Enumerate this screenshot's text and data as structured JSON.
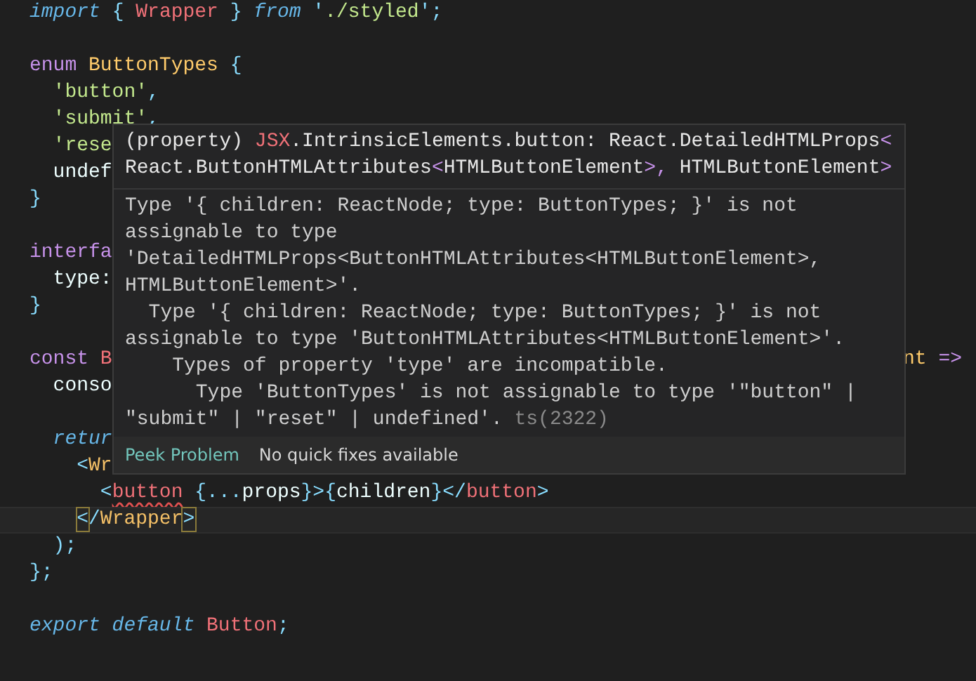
{
  "editor": {
    "lines": [
      {
        "tokens": [
          {
            "text": "import",
            "kind": "keyword-italic"
          },
          {
            "text": " { ",
            "kind": "punct"
          },
          {
            "text": "Wrapper",
            "kind": "ident"
          },
          {
            "text": " } ",
            "kind": "punct"
          },
          {
            "text": "from",
            "kind": "keyword-italic"
          },
          {
            "text": " '",
            "kind": "punct"
          },
          {
            "text": "./styled",
            "kind": "string"
          },
          {
            "text": "';",
            "kind": "punct"
          }
        ],
        "gap_after": true
      },
      {
        "tokens": [
          {
            "text": "enum ",
            "kind": "keyword"
          },
          {
            "text": "ButtonTypes",
            "kind": "type"
          },
          {
            "text": " {",
            "kind": "punct"
          }
        ]
      },
      {
        "tokens": [
          {
            "text": "  'button'",
            "kind": "string"
          },
          {
            "text": ",",
            "kind": "punct"
          }
        ]
      },
      {
        "tokens": [
          {
            "text": "  'submit'",
            "kind": "string"
          },
          {
            "text": ",",
            "kind": "punct"
          }
        ]
      },
      {
        "tokens": [
          {
            "text": "  'rese",
            "kind": "string"
          }
        ]
      },
      {
        "tokens": [
          {
            "text": "  undef",
            "kind": "plain"
          }
        ]
      },
      {
        "tokens": [
          {
            "text": "}",
            "kind": "punct"
          }
        ],
        "gap_after": true
      },
      {
        "tokens": [
          {
            "text": "interfa",
            "kind": "keyword"
          }
        ]
      },
      {
        "tokens": [
          {
            "text": "  type:",
            "kind": "plain"
          }
        ]
      },
      {
        "tokens": [
          {
            "text": "}",
            "kind": "punct"
          }
        ],
        "gap_after": true
      },
      {
        "tokens": [
          {
            "text": "const ",
            "kind": "keyword"
          },
          {
            "text": "B",
            "kind": "ident"
          }
        ],
        "tail": [
          {
            "text": "nt",
            "kind": "type"
          },
          {
            "text": " =>",
            "kind": "keyword"
          }
        ]
      },
      {
        "tokens": [
          {
            "text": "  conso",
            "kind": "plain"
          }
        ],
        "gap_after": true
      },
      {
        "tokens": [
          {
            "text": "  retur",
            "kind": "keyword-italic"
          }
        ]
      },
      {
        "tokens": [
          {
            "text": "    <",
            "kind": "punct"
          },
          {
            "text": "Wr",
            "kind": "tag"
          }
        ]
      },
      {
        "tokens": [
          {
            "text": "      <",
            "kind": "punct"
          },
          {
            "text": "button",
            "kind": "error"
          },
          {
            "text": " {",
            "kind": "punct"
          },
          {
            "text": "...",
            "kind": "punct"
          },
          {
            "text": "props",
            "kind": "plain"
          },
          {
            "text": "}>{",
            "kind": "punct"
          },
          {
            "text": "children",
            "kind": "plain"
          },
          {
            "text": "}</",
            "kind": "punct"
          },
          {
            "text": "button",
            "kind": "ident"
          },
          {
            "text": ">",
            "kind": "punct"
          }
        ]
      },
      {
        "current": true,
        "tokens": [
          {
            "text": "    <",
            "kind": "match"
          },
          {
            "text": "/",
            "kind": "punct"
          },
          {
            "text": "Wrapper",
            "kind": "tag"
          },
          {
            "text": ">",
            "kind": "match"
          }
        ]
      },
      {
        "tokens": [
          {
            "text": "  );",
            "kind": "punct"
          }
        ]
      },
      {
        "tokens": [
          {
            "text": "};",
            "kind": "punct"
          }
        ],
        "gap_after": true
      },
      {
        "tokens": [
          {
            "text": "export default ",
            "kind": "keyword-italic"
          },
          {
            "text": "Button",
            "kind": "ident"
          },
          {
            "text": ";",
            "kind": "punct"
          }
        ]
      }
    ]
  },
  "hover": {
    "signature": [
      {
        "text": "(property) ",
        "kind": "plain"
      },
      {
        "text": "JSX",
        "kind": "ident"
      },
      {
        "text": ".IntrinsicElements.button: React.DetailedHTMLProps",
        "kind": "plain"
      },
      {
        "text": "<",
        "kind": "angle"
      },
      {
        "text": "\nReact.ButtonHTMLAttributes",
        "kind": "plain"
      },
      {
        "text": "<",
        "kind": "angle"
      },
      {
        "text": "HTMLButtonElement",
        "kind": "plain"
      },
      {
        "text": ">, ",
        "kind": "angle"
      },
      {
        "text": "HTMLButtonElement",
        "kind": "plain"
      },
      {
        "text": ">",
        "kind": "angle"
      }
    ],
    "message": "Type '{ children: ReactNode; type: ButtonTypes; }' is not\nassignable to type\n'DetailedHTMLProps<ButtonHTMLAttributes<HTMLButtonElement>,\nHTMLButtonElement>'.\n  Type '{ children: ReactNode; type: ButtonTypes; }' is not\nassignable to type 'ButtonHTMLAttributes<HTMLButtonElement>'.\n    Types of property 'type' are incompatible.\n      Type 'ButtonTypes' is not assignable to type '\"button\" |\n\"submit\" | \"reset\" | undefined'.",
    "code": "ts(2322)",
    "actions": [
      {
        "label": "Peek Problem",
        "kind": "link"
      },
      {
        "label": "No quick fixes available",
        "kind": "note"
      }
    ]
  }
}
